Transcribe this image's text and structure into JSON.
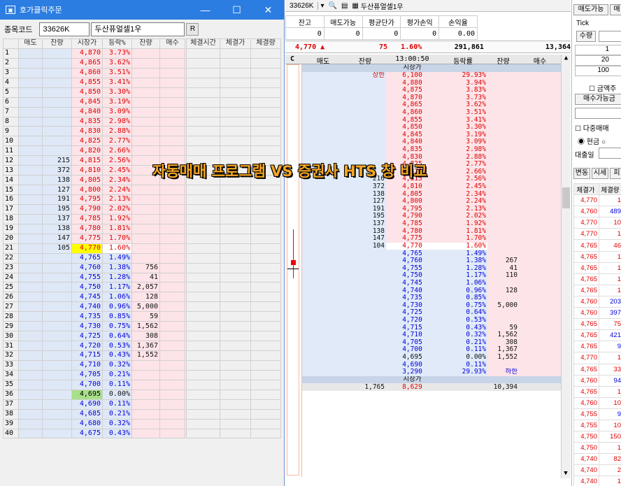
{
  "left_window": {
    "title": "호가클릭주문",
    "code_label": "종목코드",
    "code_value": "33626K",
    "name_value": "두산퓨얼셀1우",
    "refresh_label": "R",
    "headers": [
      "",
      "매도",
      "잔량",
      "시장가",
      "등락%",
      "잔량",
      "매수"
    ],
    "rows": [
      [
        "1",
        "",
        "",
        "4,870",
        "3.73%",
        "",
        "",
        "ask"
      ],
      [
        "2",
        "",
        "",
        "4,865",
        "3.62%",
        "",
        "",
        "ask"
      ],
      [
        "3",
        "",
        "",
        "4,860",
        "3.51%",
        "",
        "",
        "ask"
      ],
      [
        "4",
        "",
        "",
        "4,855",
        "3.41%",
        "",
        "",
        "ask"
      ],
      [
        "5",
        "",
        "",
        "4,850",
        "3.30%",
        "",
        "",
        "ask"
      ],
      [
        "6",
        "",
        "",
        "4,845",
        "3.19%",
        "",
        "",
        "ask"
      ],
      [
        "7",
        "",
        "",
        "4,840",
        "3.09%",
        "",
        "",
        "ask"
      ],
      [
        "8",
        "",
        "",
        "4,835",
        "2.98%",
        "",
        "",
        "ask"
      ],
      [
        "9",
        "",
        "",
        "4,830",
        "2.88%",
        "",
        "",
        "ask"
      ],
      [
        "10",
        "",
        "",
        "4,825",
        "2.77%",
        "",
        "",
        "ask"
      ],
      [
        "11",
        "",
        "",
        "4,820",
        "2.66%",
        "",
        "",
        "ask"
      ],
      [
        "12",
        "",
        "215",
        "4,815",
        "2.56%",
        "",
        "",
        "ask"
      ],
      [
        "13",
        "",
        "372",
        "4,810",
        "2.45%",
        "",
        "",
        "ask"
      ],
      [
        "14",
        "",
        "138",
        "4,805",
        "2.34%",
        "",
        "",
        "ask"
      ],
      [
        "15",
        "",
        "127",
        "4,800",
        "2.24%",
        "",
        "",
        "ask"
      ],
      [
        "16",
        "",
        "191",
        "4,795",
        "2.13%",
        "",
        "",
        "ask"
      ],
      [
        "17",
        "",
        "195",
        "4,790",
        "2.02%",
        "",
        "",
        "ask"
      ],
      [
        "18",
        "",
        "137",
        "4,785",
        "1.92%",
        "",
        "",
        "ask"
      ],
      [
        "19",
        "",
        "138",
        "4,780",
        "1.81%",
        "",
        "",
        "ask"
      ],
      [
        "20",
        "",
        "147",
        "4,775",
        "1.70%",
        "",
        "",
        "ask"
      ],
      [
        "21",
        "",
        "105",
        "4,770",
        "1.60%",
        "",
        "",
        "cur"
      ],
      [
        "22",
        "",
        "",
        "4,765",
        "1.49%",
        "",
        "",
        "bid"
      ],
      [
        "23",
        "",
        "",
        "4,760",
        "1.38%",
        "756",
        "",
        "bid"
      ],
      [
        "24",
        "",
        "",
        "4,755",
        "1.28%",
        "41",
        "",
        "bid"
      ],
      [
        "25",
        "",
        "",
        "4,750",
        "1.17%",
        "2,057",
        "",
        "bid"
      ],
      [
        "26",
        "",
        "",
        "4,745",
        "1.06%",
        "128",
        "",
        "bid"
      ],
      [
        "27",
        "",
        "",
        "4,740",
        "0.96%",
        "5,000",
        "",
        "bid"
      ],
      [
        "28",
        "",
        "",
        "4,735",
        "0.85%",
        "59",
        "",
        "bid"
      ],
      [
        "29",
        "",
        "",
        "4,730",
        "0.75%",
        "1,562",
        "",
        "bid"
      ],
      [
        "30",
        "",
        "",
        "4,725",
        "0.64%",
        "308",
        "",
        "bid"
      ],
      [
        "31",
        "",
        "",
        "4,720",
        "0.53%",
        "1,367",
        "",
        "bid"
      ],
      [
        "32",
        "",
        "",
        "4,715",
        "0.43%",
        "1,552",
        "",
        "bid"
      ],
      [
        "33",
        "",
        "",
        "4,710",
        "0.32%",
        "",
        "",
        "bid"
      ],
      [
        "34",
        "",
        "",
        "4,705",
        "0.21%",
        "",
        "",
        "bid"
      ],
      [
        "35",
        "",
        "",
        "4,700",
        "0.11%",
        "",
        "",
        "bid"
      ],
      [
        "36",
        "",
        "",
        "4,695",
        "0.00%",
        "",
        "",
        "base"
      ],
      [
        "37",
        "",
        "",
        "4,690",
        "0.11%",
        "",
        "",
        "bid"
      ],
      [
        "38",
        "",
        "",
        "4,685",
        "0.21%",
        "",
        "",
        "bid"
      ],
      [
        "39",
        "",
        "",
        "4,680",
        "0.32%",
        "",
        "",
        "bid"
      ],
      [
        "40",
        "",
        "",
        "4,675",
        "0.43%",
        "",
        "",
        "bid"
      ]
    ],
    "right_headers": [
      "체결시간",
      "체결가",
      "체결량"
    ]
  },
  "overlay_text": "자동매매 프로그램 VS 증권사 HTS 창 비교",
  "main": {
    "code": "33626K",
    "name": "두산퓨얼셀1우",
    "summary_headers": [
      "잔고",
      "매도가능",
      "평균단가",
      "평가손익",
      "손익율"
    ],
    "summary_values": [
      "0",
      "0",
      "0",
      "0",
      "0.00"
    ],
    "price": "4,770 ▲",
    "change": "75",
    "rate": "1.60%",
    "volume": "291,861",
    "amount": "13,364",
    "grid_headers": [
      "매도",
      "잔량",
      "13:00:50",
      "등락률",
      "잔량",
      "매수"
    ],
    "c_label": "C",
    "rows": [
      [
        "",
        "",
        "시장가",
        "",
        "",
        "",
        "h"
      ],
      [
        "",
        "상한",
        "6,100",
        "29.93%",
        "",
        "",
        "a"
      ],
      [
        "",
        "",
        "4,880",
        "3.94%",
        "",
        "",
        "a"
      ],
      [
        "",
        "",
        "4,875",
        "3.83%",
        "",
        "",
        "a"
      ],
      [
        "",
        "",
        "4,870",
        "3.73%",
        "",
        "",
        "a"
      ],
      [
        "",
        "",
        "4,865",
        "3.62%",
        "",
        "",
        "a"
      ],
      [
        "",
        "",
        "4,860",
        "3.51%",
        "",
        "",
        "a"
      ],
      [
        "",
        "",
        "4,855",
        "3.41%",
        "",
        "",
        "a"
      ],
      [
        "",
        "",
        "4,850",
        "3.30%",
        "",
        "",
        "a"
      ],
      [
        "",
        "",
        "4,845",
        "3.19%",
        "",
        "",
        "a"
      ],
      [
        "",
        "",
        "4,840",
        "3.09%",
        "",
        "",
        "a"
      ],
      [
        "",
        "",
        "4,835",
        "2.98%",
        "",
        "",
        "a"
      ],
      [
        "",
        "",
        "4,830",
        "2.88%",
        "",
        "",
        "a"
      ],
      [
        "",
        "",
        "4,825",
        "2.77%",
        "",
        "",
        "a"
      ],
      [
        "",
        "",
        "4,820",
        "2.66%",
        "",
        "",
        "a"
      ],
      [
        "",
        "216",
        "4,815",
        "2.56%",
        "",
        "",
        "a"
      ],
      [
        "",
        "372",
        "4,810",
        "2.45%",
        "",
        "",
        "a"
      ],
      [
        "",
        "138",
        "4,805",
        "2.34%",
        "",
        "",
        "a"
      ],
      [
        "",
        "127",
        "4,800",
        "2.24%",
        "",
        "",
        "a"
      ],
      [
        "",
        "191",
        "4,795",
        "2.13%",
        "",
        "",
        "a"
      ],
      [
        "",
        "195",
        "4,790",
        "2.02%",
        "",
        "",
        "a"
      ],
      [
        "",
        "137",
        "4,785",
        "1.92%",
        "",
        "",
        "a"
      ],
      [
        "",
        "138",
        "4,780",
        "1.81%",
        "",
        "",
        "a"
      ],
      [
        "",
        "147",
        "4,775",
        "1.70%",
        "",
        "",
        "a"
      ],
      [
        "",
        "104",
        "4,770",
        "1.60%",
        "",
        "",
        "c"
      ],
      [
        "",
        "",
        "4,765",
        "1.49%",
        "",
        "",
        "b"
      ],
      [
        "",
        "",
        "4,760",
        "1.38%",
        "267",
        "",
        "b"
      ],
      [
        "",
        "",
        "4,755",
        "1.28%",
        "41",
        "",
        "b"
      ],
      [
        "",
        "",
        "4,750",
        "1.17%",
        "110",
        "",
        "b"
      ],
      [
        "",
        "",
        "4,745",
        "1.06%",
        "",
        "",
        "b"
      ],
      [
        "",
        "",
        "4,740",
        "0.96%",
        "128",
        "",
        "b"
      ],
      [
        "",
        "",
        "4,735",
        "0.85%",
        "",
        "",
        "b"
      ],
      [
        "",
        "",
        "4,730",
        "0.75%",
        "5,000",
        "",
        "b"
      ],
      [
        "",
        "",
        "4,725",
        "0.64%",
        "",
        "",
        "b"
      ],
      [
        "",
        "",
        "4,720",
        "0.53%",
        "",
        "",
        "b"
      ],
      [
        "",
        "",
        "4,715",
        "0.43%",
        "59",
        "",
        "b"
      ],
      [
        "",
        "",
        "4,710",
        "0.32%",
        "1,562",
        "",
        "b"
      ],
      [
        "",
        "",
        "4,705",
        "0.21%",
        "308",
        "",
        "b"
      ],
      [
        "",
        "",
        "4,700",
        "0.11%",
        "1,367",
        "",
        "b"
      ],
      [
        "",
        "",
        "4,695",
        "0.00%",
        "1,552",
        "",
        "z"
      ],
      [
        "",
        "",
        "4,690",
        "0.11%",
        "",
        "",
        "d"
      ],
      [
        "",
        "",
        "3,290",
        "29.93%",
        "하한",
        "",
        "d"
      ],
      [
        "",
        "",
        "시장가",
        "",
        "",
        "",
        "h"
      ],
      [
        "",
        "1,765",
        "8,629",
        "",
        "10,394",
        "",
        "t"
      ]
    ]
  },
  "right": {
    "tabs": [
      "매도가능",
      "매"
    ],
    "tick_label": "Tick",
    "qty_label": "수량",
    "qty_rows": [
      "1",
      "20",
      "100"
    ],
    "amount_check": "금액주",
    "buy_avail": "매수가능금",
    "multi": "다중매매",
    "cash": "현금",
    "loan": "대출일",
    "sub_tabs": [
      "변동",
      "시세",
      "피"
    ],
    "trade_headers": [
      "체결가",
      "체결량"
    ],
    "trades": [
      [
        "4,770",
        "1"
      ],
      [
        "4,760",
        "489"
      ],
      [
        "4,770",
        "10"
      ],
      [
        "4,770",
        "1"
      ],
      [
        "4,765",
        "46"
      ],
      [
        "4,765",
        "1"
      ],
      [
        "4,765",
        "1"
      ],
      [
        "4,765",
        "1"
      ],
      [
        "4,765",
        "1"
      ],
      [
        "4,760",
        "203"
      ],
      [
        "4,760",
        "397"
      ],
      [
        "4,765",
        "75"
      ],
      [
        "4,765",
        "421"
      ],
      [
        "4,765",
        "9"
      ],
      [
        "4,770",
        "1"
      ],
      [
        "4,765",
        "33"
      ],
      [
        "4,760",
        "94"
      ],
      [
        "4,765",
        "1"
      ],
      [
        "4,760",
        "10"
      ],
      [
        "4,755",
        "9"
      ],
      [
        "4,755",
        "10"
      ],
      [
        "4,750",
        "150"
      ],
      [
        "4,750",
        "1"
      ],
      [
        "4,740",
        "82"
      ],
      [
        "4,740",
        "2"
      ],
      [
        "4,740",
        "1"
      ],
      [
        "4,740",
        "1"
      ]
    ]
  }
}
